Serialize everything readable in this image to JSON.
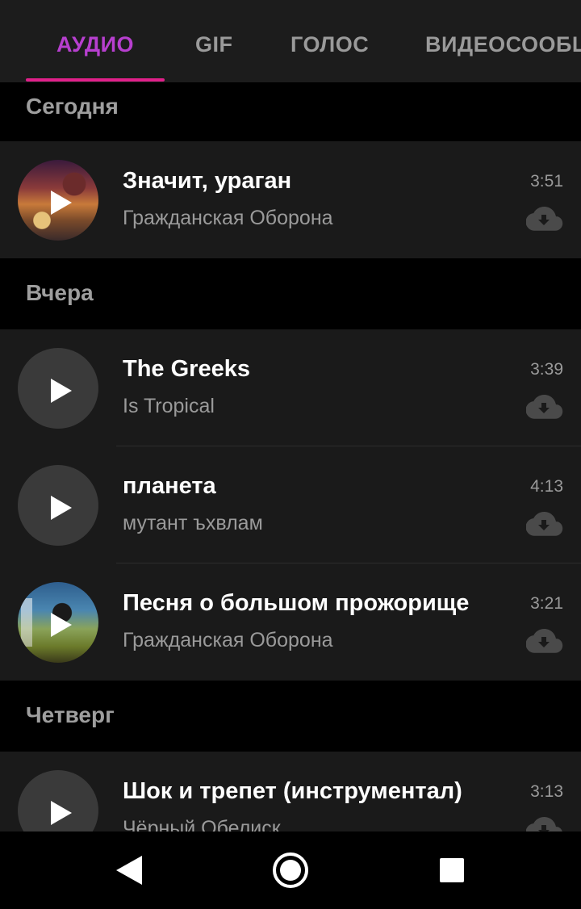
{
  "tabs": [
    {
      "label": "АУДИО",
      "active": true
    },
    {
      "label": "GIF",
      "active": false
    },
    {
      "label": "ГОЛОС",
      "active": false
    },
    {
      "label": "ВИДЕОСООБЩ",
      "active": false
    }
  ],
  "accent_color": "#b73fcf",
  "indicator_color": "#e0208a",
  "sections": [
    {
      "header": "Сегодня",
      "tracks": [
        {
          "title": "Значит, ураган",
          "artist": "Гражданская Оборона",
          "duration": "3:51",
          "cover": "album-art"
        }
      ]
    },
    {
      "header": "Вчера",
      "tracks": [
        {
          "title": "The Greeks",
          "artist": "Is Tropical",
          "duration": "3:39",
          "cover": "placeholder"
        },
        {
          "title": "планета",
          "artist": "мутант ъхвлам",
          "duration": "4:13",
          "cover": "placeholder"
        },
        {
          "title": "Песня о большом прожорище",
          "artist": "Гражданская Оборона",
          "duration": "3:21",
          "cover": "album-art"
        }
      ]
    },
    {
      "header": "Четверг",
      "tracks": [
        {
          "title": "Шок и трепет (инструментал)",
          "artist": "Чёрный Обелиск",
          "duration": "3:13",
          "cover": "placeholder"
        }
      ]
    }
  ],
  "icons": {
    "play": "play-icon",
    "download": "cloud-download-icon",
    "back": "back-triangle-icon",
    "home": "home-circle-icon",
    "recents": "recents-square-icon"
  }
}
